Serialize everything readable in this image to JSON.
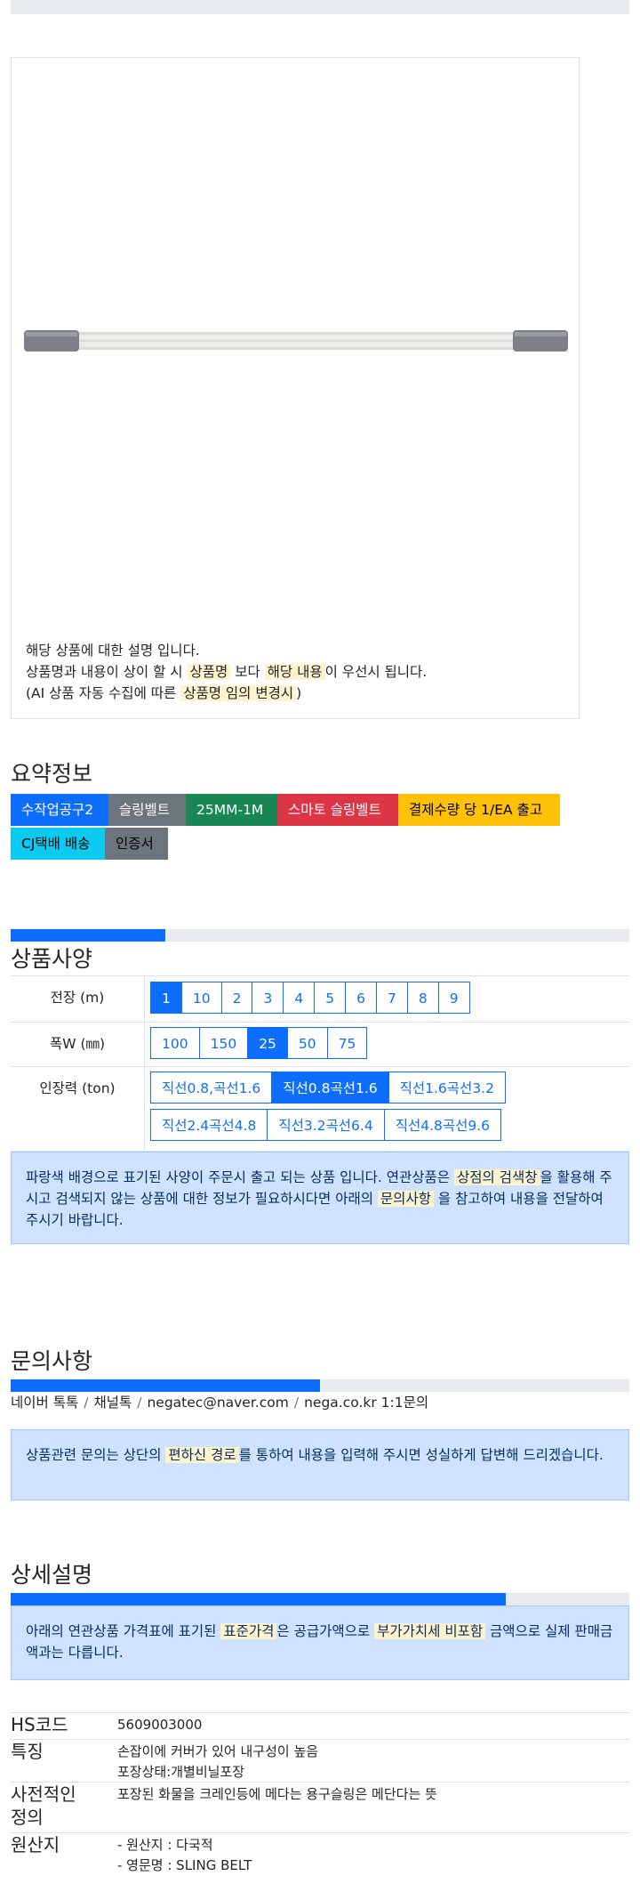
{
  "image_caption": {
    "line1": "해당 상품에 대한 설명 입니다.",
    "line2_pre": "상품명과 내용이 상이 할 시 ",
    "line2_hl1": "상품명",
    "line2_mid": " 보다 ",
    "line2_hl2": "해당 내용",
    "line2_post": "이 우선시 됩니다.",
    "line3_pre": "(AI 상품 자동 수집에 따른 ",
    "line3_hl": "상품명 임의 변경시",
    "line3_post": ")"
  },
  "summary": {
    "title": "요약정보",
    "badges": [
      {
        "label": "수작업공구2",
        "color": "#0d6efd"
      },
      {
        "label": "슬링벨트",
        "color": "#6c757d"
      },
      {
        "label": "25MM-1M",
        "color": "#198754"
      },
      {
        "label": "스마토 슬링벨트",
        "color": "#dc3545"
      },
      {
        "label": "결제수량 당 1/EA 출고",
        "color": "#ffc107"
      },
      {
        "label": "CJ택배 배송",
        "color": "#0dcaf0"
      },
      {
        "label": "인증서",
        "color": "#6c757d"
      }
    ]
  },
  "spec": {
    "title": "상품사양",
    "progress": 0.25,
    "rows": [
      {
        "label": "전장 (m)",
        "options": [
          "1",
          "10",
          "2",
          "3",
          "4",
          "5",
          "6",
          "7",
          "8",
          "9"
        ],
        "selected": "1"
      },
      {
        "label": "폭W (㎜)",
        "options": [
          "100",
          "150",
          "25",
          "50",
          "75"
        ],
        "selected": "25"
      },
      {
        "label": "인장력 (ton)",
        "options": [
          "직선0.8,곡선1.6",
          "직선0.8곡선1.6",
          "직선1.6곡선3.2",
          "직선2.4곡선4.8",
          "직선3.2곡선6.4",
          "직선4.8곡선9.6"
        ],
        "selected": "직선0.8곡선1.6"
      }
    ],
    "notice_pre": "파랑색 배경으로 표기된 사양이 주문시 출고 되는 상품 입니다. 연관상품은 ",
    "notice_hl1": "상점의 검색창",
    "notice_mid": "을 활용해 주시고 검색되지 않는 상품에 대한 정보가 필요하시다면 아래의 ",
    "notice_hl2": "문의사항",
    "notice_post": " 을 참고하여 내용을 전달하여 주시기 바랍니다."
  },
  "inquiry": {
    "title": "문의사항",
    "progress": 0.5,
    "links": [
      "네이버 톡톡",
      "채널톡",
      "negatec@naver.com",
      "nega.co.kr 1:1문의"
    ],
    "separator": "/",
    "notice_pre": "상품관련 문의는 상단의 ",
    "notice_hl": "편하신 경로",
    "notice_post": "를 통하여 내용을 입력해 주시면 성실하게 답변해 드리겠습니다."
  },
  "detail": {
    "title": "상세설명",
    "progress": 0.8,
    "notice_pre": "아래의 연관상품 가격표에 표기된 ",
    "notice_hl1": "표준가격",
    "notice_mid": "은 공급가액으로 ",
    "notice_hl2": "부가가치세 비포함",
    "notice_post": " 금액으로 실제 판매금액과는 다릅니다.",
    "rows": [
      {
        "key": "HS코드",
        "lines": [
          "5609003000"
        ]
      },
      {
        "key": "특징",
        "lines": [
          "손잡이에 커버가 있어 내구성이 높음",
          "포장상태:개별비닐포장"
        ]
      },
      {
        "key": "사전적인 정의",
        "lines": [
          "포장된 화물을 크레인등에 메다는 용구슬링은 메단다는 뜻"
        ]
      },
      {
        "key": "원산지",
        "lines": [
          "- 원산지 : 다국적",
          "- 영문명 : SLING BELT"
        ]
      }
    ]
  }
}
